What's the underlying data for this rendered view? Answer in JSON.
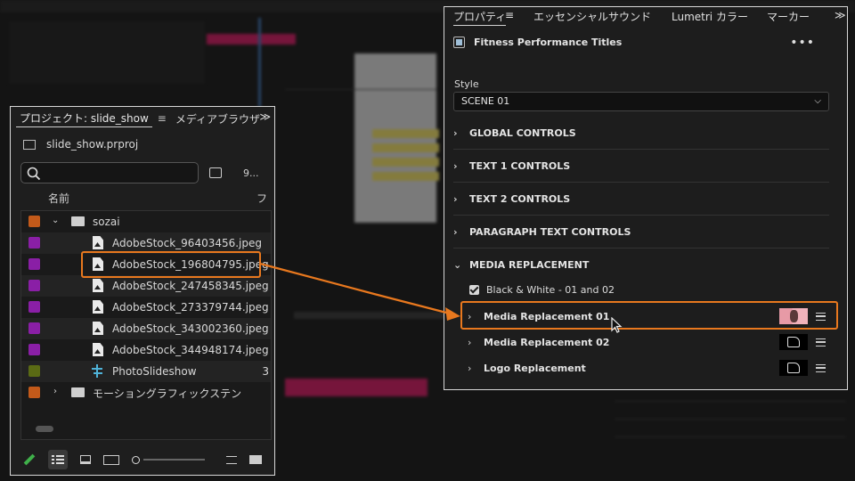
{
  "project_panel": {
    "tab_label": "プロジェクト: slide_show",
    "tab2_label": "メディアブラウザ",
    "overflow": "≫",
    "project_file": "slide_show.prproj",
    "search_placeholder": "",
    "item_count": "9...",
    "column_name": "名前",
    "column_more": "フ",
    "items": [
      {
        "name": "sozai",
        "type": "folder",
        "expanded": true,
        "color": "#c35a1a"
      },
      {
        "name": "AdobeStock_96403456.jpeg",
        "type": "image",
        "color": "#8a1fa6"
      },
      {
        "name": "AdobeStock_196804795.jpeg",
        "type": "image",
        "color": "#8a1fa6",
        "highlighted": true
      },
      {
        "name": "AdobeStock_247458345.jpeg",
        "type": "image",
        "color": "#8a1fa6"
      },
      {
        "name": "AdobeStock_273379744.jpeg",
        "type": "image",
        "color": "#8a1fa6"
      },
      {
        "name": "AdobeStock_343002360.jpeg",
        "type": "image",
        "color": "#8a1fa6"
      },
      {
        "name": "AdobeStock_344948174.jpeg",
        "type": "image",
        "color": "#8a1fa6"
      },
      {
        "name": "PhotoSlideshow",
        "type": "sequence",
        "color": "#5a6a14",
        "extra": "3"
      },
      {
        "name": "モーショングラフィックステン",
        "type": "folder",
        "expanded": false,
        "color": "#c35a1a"
      }
    ]
  },
  "properties_panel": {
    "tabs": [
      "プロパティ",
      "エッセンシャルサウンド",
      "Lumetri カラー",
      "マーカー"
    ],
    "overflow": "≫",
    "title": "Fitness Performance Titles",
    "more": "•••",
    "style_label": "Style",
    "style_value": "SCENE 01",
    "sections": [
      "GLOBAL CONTROLS",
      "TEXT 1 CONTROLS",
      "TEXT 2 CONTROLS",
      "PARAGRAPH TEXT CONTROLS",
      "MEDIA REPLACEMENT"
    ],
    "checkbox_label": "Black & White - 01 and 02",
    "media_rows": [
      {
        "label": "Media Replacement 01",
        "thumb": "image"
      },
      {
        "label": "Media Replacement 02",
        "thumb": "placeholder"
      },
      {
        "label": "Logo Replacement",
        "thumb": "placeholder"
      }
    ]
  },
  "colors": {
    "highlight": "#e8781e",
    "accent_green": "#3fb04a"
  }
}
